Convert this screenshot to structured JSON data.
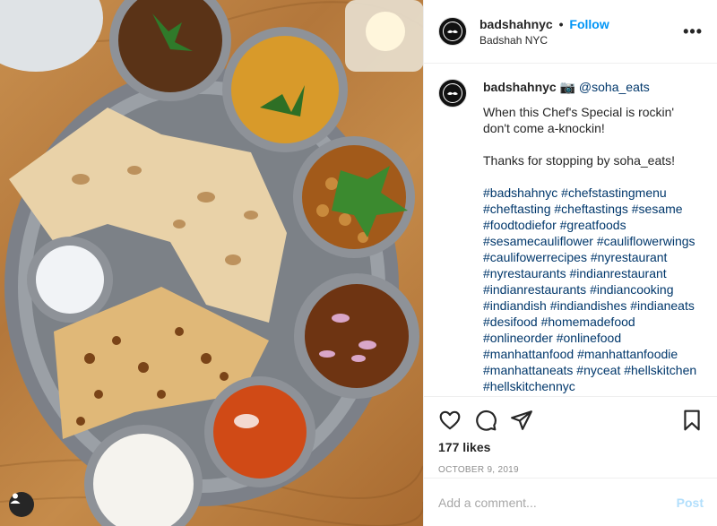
{
  "header": {
    "username": "badshahnyc",
    "separator": "•",
    "follow_label": "Follow",
    "location": "Badshah NYC",
    "more_label": "•••"
  },
  "caption": {
    "username": "badshahnyc",
    "camera_glyph": "📷",
    "mention": "@soha_eats",
    "text1_line1": "When this Chef's Special is rockin'",
    "text1_line2": "don't come a-knockin!",
    "text2": "Thanks for stopping by soha_eats!",
    "hashtag_lines": [
      "#badshahnyc #chefstastingmenu",
      "#cheftasting #cheftastings #sesame",
      "#foodtodiefor #greatfoods",
      "#sesamecauliflower #cauliflowerwings",
      "#caulifowerrecipes #nyrestaurant",
      "#nyrestaurants #indianrestaurant",
      "#indianrestaurants #indiancooking",
      "#indiandish #indiandishes #indianeats",
      "#desifood #homemadefood",
      "#onlineorder #onlinefood",
      "#manhattanfood #manhattanfoodie",
      "#manhattaneats #nyceat #hellskitchen",
      "#hellskitchennyc"
    ]
  },
  "actions": {
    "likes": "177 likes",
    "date": "OCTOBER 9, 2019"
  },
  "comment": {
    "placeholder": "Add a comment...",
    "post_label": "Post"
  },
  "colors": {
    "link": "#00376b",
    "follow": "#0095f6",
    "post_disabled": "#b2dffc",
    "muted": "#8e8e8e"
  }
}
